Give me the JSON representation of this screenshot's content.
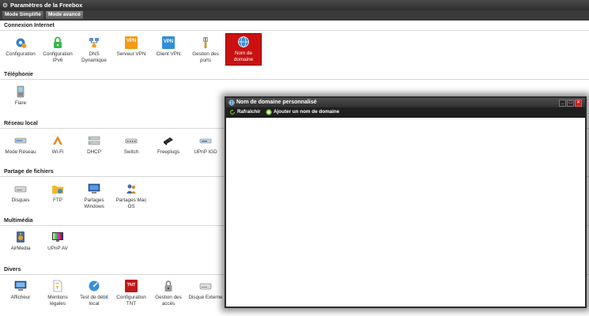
{
  "window": {
    "title": "Paramètres de la Freebox"
  },
  "modes": [
    {
      "label": "Mode Simplifié",
      "active": false
    },
    {
      "label": "Mode avancé",
      "active": true
    }
  ],
  "sections": {
    "connexion": {
      "title": "Connexion Internet",
      "items": [
        {
          "label": "Configuration",
          "icon": "gear-icon"
        },
        {
          "label": "Configuration IPv6",
          "icon": "ipv6-icon"
        },
        {
          "label": "DNS Dynamique",
          "icon": "dns-icon"
        },
        {
          "label": "Serveur VPN",
          "icon": "vpn-server-icon",
          "badge": "VPN"
        },
        {
          "label": "Client VPN",
          "icon": "vpn-client-icon",
          "badge": "VPN"
        },
        {
          "label": "Gestion des ports",
          "icon": "ports-icon"
        },
        {
          "label": "Nom de domaine",
          "icon": "globe-icon"
        }
      ]
    },
    "telephonie": {
      "title": "Téléphonie",
      "items": [
        {
          "label": "Fiare",
          "icon": "phone-icon"
        }
      ]
    },
    "reseau": {
      "title": "Réseau local",
      "items": [
        {
          "label": "Mode Réseau",
          "icon": "network-mode-icon"
        },
        {
          "label": "Wi-Fi",
          "icon": "wifi-icon"
        },
        {
          "label": "DHCP",
          "icon": "dhcp-icon"
        },
        {
          "label": "Switch",
          "icon": "switch-icon"
        },
        {
          "label": "Freeplugs",
          "icon": "freeplug-icon"
        },
        {
          "label": "UPnP IGD",
          "icon": "upnp-igd-icon"
        }
      ]
    },
    "partage": {
      "title": "Partage de fichiers",
      "items": [
        {
          "label": "Disques",
          "icon": "disk-icon"
        },
        {
          "label": "FTP",
          "icon": "folder-icon"
        },
        {
          "label": "Partages Windows",
          "icon": "windows-share-icon"
        },
        {
          "label": "Partages Mac OS",
          "icon": "mac-share-icon"
        }
      ]
    },
    "multimedia": {
      "title": "Multimédia",
      "items": [
        {
          "label": "AirMedia",
          "icon": "airmedia-icon"
        },
        {
          "label": "UPnP AV",
          "icon": "upnp-av-icon"
        }
      ]
    },
    "divers": {
      "title": "Divers",
      "items": [
        {
          "label": "Afficheur",
          "icon": "monitor-icon"
        },
        {
          "label": "Mentions légales",
          "icon": "legal-icon"
        },
        {
          "label": "Test de débit local",
          "icon": "speedtest-icon"
        },
        {
          "label": "Configuration TNT",
          "icon": "tnt-icon",
          "badge": "TNT"
        },
        {
          "label": "Gestion des accès",
          "icon": "lock-icon"
        },
        {
          "label": "Disque Externe",
          "icon": "external-disk-icon"
        }
      ]
    }
  },
  "modal": {
    "title": "Nom de domaine personnalisé",
    "buttons": {
      "minimize": "_",
      "maximize": "□",
      "close": "×"
    },
    "toolbar": {
      "refresh_label": "Rafraîchir",
      "add_label": "Ajouter un nom de domaine"
    }
  }
}
